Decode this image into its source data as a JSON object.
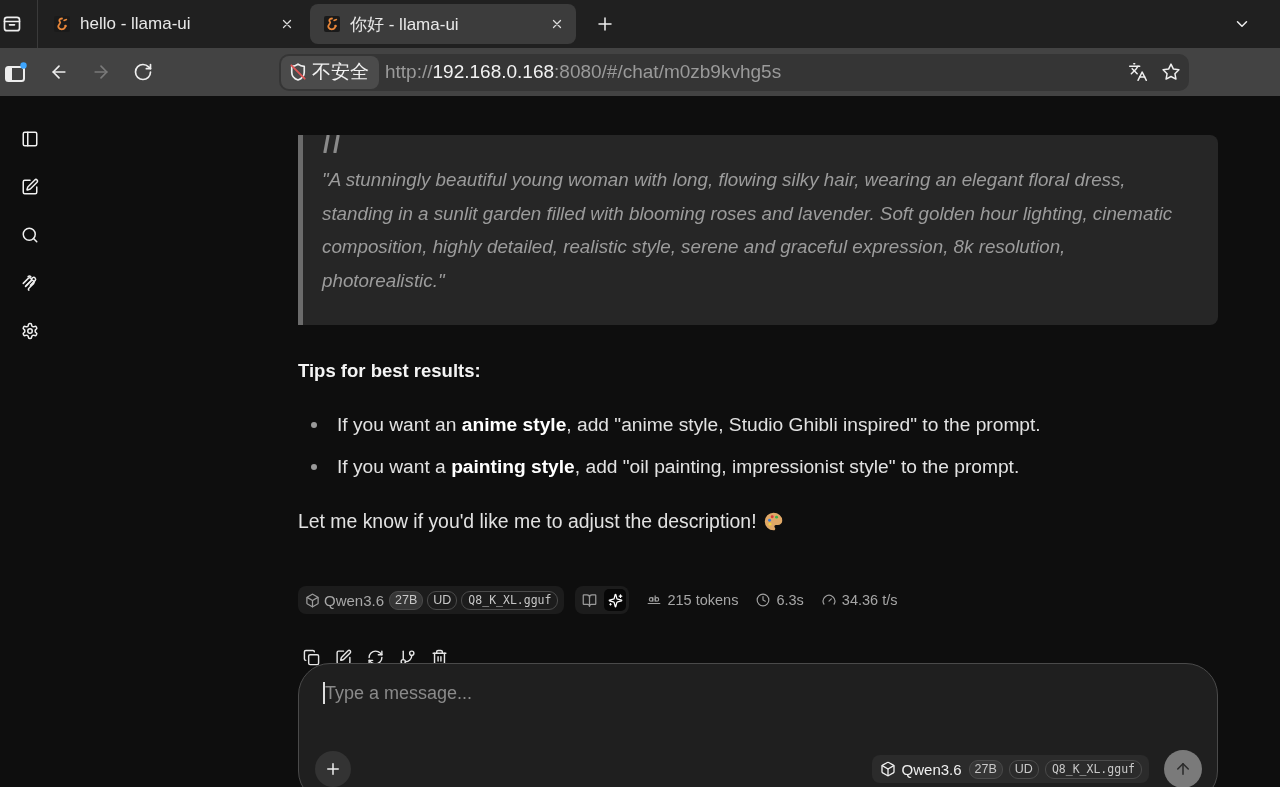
{
  "browser": {
    "tabs": [
      {
        "title": "hello - llama-ui",
        "selected": false
      },
      {
        "title": "你好 - llama-ui",
        "selected": true
      }
    ],
    "forward_disabled": true,
    "security_label": "不安全",
    "url": {
      "scheme": "http://",
      "host": "192.168.0.168",
      "rest": ":8080/#/chat/m0zb9kvhg5s"
    }
  },
  "message": {
    "quote": "\"A stunningly beautiful young woman with long, flowing silky hair, wearing an elegant floral dress, standing in a sunlit garden filled with blooming roses and lavender. Soft golden hour lighting, cinematic composition, highly detailed, realistic style, serene and graceful expression, 8k resolution, photorealistic.\"",
    "tips_heading": "Tips for best results:",
    "tips": [
      "If you want an **anime style**, add \"anime style, Studio Ghibli inspired\" to the prompt.",
      "If you want a **painting style**, add \"oil painting, impressionist style\" to the prompt."
    ],
    "closing": "Let me know if you'd like me to adjust the description!",
    "model": {
      "name": "Qwen3.6",
      "badges": [
        {
          "kind": "params",
          "text": "27B"
        },
        {
          "kind": "quant",
          "text": "UD"
        },
        {
          "kind": "file",
          "text": "Q8_K_XL.gguf"
        }
      ]
    },
    "view_toggle": [
      {
        "kind": "book",
        "selected": false
      },
      {
        "kind": "sparkles",
        "selected": true
      }
    ],
    "stats": [
      {
        "kind": "tokens",
        "text": "215 tokens"
      },
      {
        "kind": "time",
        "text": "6.3s"
      },
      {
        "kind": "speed",
        "text": "34.36 t/s"
      }
    ]
  },
  "composer": {
    "placeholder": "Type a message...",
    "model": {
      "name": "Qwen3.6",
      "badges": [
        {
          "kind": "params",
          "text": "27B"
        },
        {
          "kind": "quant",
          "text": "UD"
        },
        {
          "kind": "file",
          "text": "Q8_K_XL.gguf"
        }
      ]
    },
    "send_disabled": true
  }
}
